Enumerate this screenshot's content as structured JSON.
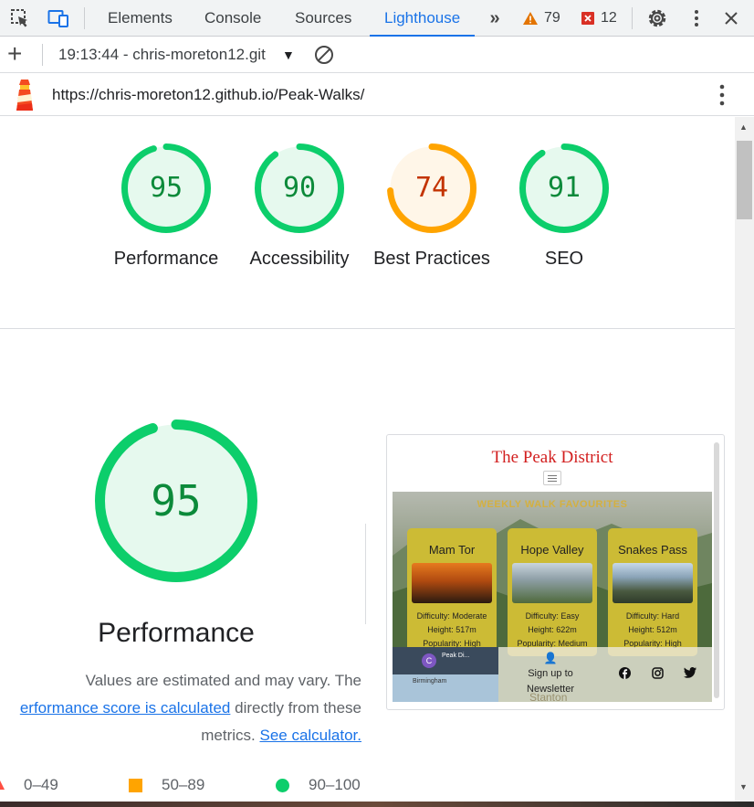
{
  "devtools": {
    "tabs": [
      {
        "label": "Elements"
      },
      {
        "label": "Console"
      },
      {
        "label": "Sources"
      },
      {
        "label": "Lighthouse"
      }
    ],
    "warnings_count": "79",
    "errors_count": "12",
    "colors": {
      "active_tab": "#1a73e8",
      "warning": "#e37400",
      "error": "#d93025"
    }
  },
  "report_bar": {
    "selected_report": "19:13:44 - chris-moreton12.git"
  },
  "url_bar": {
    "url": "https://chris-moreton12.github.io/Peak-Walks/"
  },
  "scores": [
    {
      "value": 95,
      "label": "Performance",
      "status": "pass"
    },
    {
      "value": 90,
      "label": "Accessibility",
      "status": "pass"
    },
    {
      "value": 74,
      "label": "Best Practices",
      "status": "average"
    },
    {
      "value": 91,
      "label": "SEO",
      "status": "pass"
    }
  ],
  "score_colors": {
    "pass": {
      "stroke": "#0cce6b",
      "fill": "#e6f9ee",
      "text": "#0c8a3a"
    },
    "average": {
      "stroke": "#ffa400",
      "fill": "#fff6e8",
      "text": "#c33300"
    }
  },
  "performance": {
    "score": 95,
    "title": "Performance",
    "desc_prefix": "Values are estimated and may vary. The",
    "desc_link": "erformance score is calculated",
    "desc_middle": "directly from these metrics.",
    "calculator_link": "See calculator."
  },
  "legend": [
    {
      "range": "0–49",
      "shape": "triangle",
      "color": "#ff4e42"
    },
    {
      "range": "50–89",
      "shape": "square",
      "color": "#ffa400"
    },
    {
      "range": "90–100",
      "shape": "circle",
      "color": "#0cce6b"
    }
  ],
  "screenshot": {
    "site_title": "The Peak District",
    "section_heading": "WEEKLY WALK FAVOURITES",
    "cards": [
      {
        "name": "Mam Tor",
        "difficulty": "Difficulty: Moderate",
        "height": "Height: 517m",
        "popularity": "Popularity: High"
      },
      {
        "name": "Hope Valley",
        "difficulty": "Difficulty: Easy",
        "height": "Height: 622m",
        "popularity": "Popularity: Medium"
      },
      {
        "name": "Snakes Pass",
        "difficulty": "Difficulty: Hard",
        "height": "Height: 512m",
        "popularity": "Popularity: High"
      }
    ],
    "signup_line1": "Sign up to",
    "signup_line2": "Newsletter",
    "behind_text": "Stanton",
    "map_title": "Peak Di...",
    "map_city": "Birmingham"
  }
}
